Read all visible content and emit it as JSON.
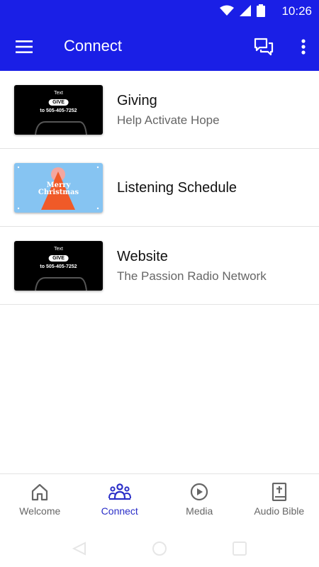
{
  "status_bar": {
    "time": "10:26",
    "icons": [
      "wifi-icon",
      "signal-icon",
      "battery-icon"
    ]
  },
  "app_bar": {
    "title": "Connect",
    "menu_icon": "hamburger-menu-icon",
    "chat_icon": "chat-icon",
    "more_icon": "more-vertical-icon"
  },
  "items": [
    {
      "title": "Giving",
      "subtitle": "Help Activate Hope",
      "thumb": {
        "style": "black",
        "line1": "Text",
        "pill": "GIVE",
        "line2": "to 505-405-7252"
      }
    },
    {
      "title": "Listening Schedule",
      "subtitle": "",
      "thumb": {
        "style": "blue",
        "line1": "Merry",
        "line2": "Christmas"
      }
    },
    {
      "title": "Website",
      "subtitle": "The Passion Radio Network",
      "thumb": {
        "style": "black",
        "line1": "Text",
        "pill": "GIVE",
        "line2": "to 505-405-7252"
      }
    }
  ],
  "bottom_nav": [
    {
      "label": "Welcome",
      "icon": "home-icon",
      "active": false
    },
    {
      "label": "Connect",
      "icon": "people-icon",
      "active": true
    },
    {
      "label": "Media",
      "icon": "play-icon",
      "active": false
    },
    {
      "label": "Audio Bible",
      "icon": "bible-icon",
      "active": false
    }
  ],
  "colors": {
    "primary": "#1a1fe6",
    "active": "#2a2ec8",
    "divider": "#e3e3e3"
  }
}
